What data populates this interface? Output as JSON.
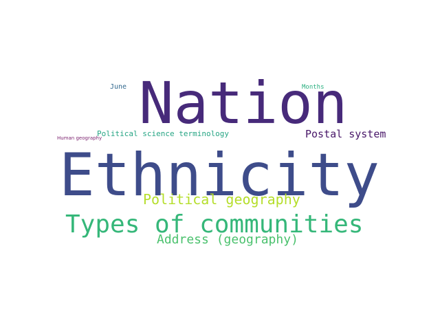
{
  "words": {
    "nation": {
      "text": "Nation",
      "color": "#472a7a"
    },
    "ethnicity": {
      "text": "Ethnicity",
      "color": "#3e4c8a"
    },
    "types": {
      "text": "Types of communities",
      "color": "#35b779"
    },
    "polgeo": {
      "text": "Political geography",
      "color": "#b5de2b"
    },
    "address": {
      "text": "Address (geography)",
      "color": "#4ac16d"
    },
    "postal": {
      "text": "Postal system",
      "color": "#481668"
    },
    "polsci": {
      "text": "Political science terminology",
      "color": "#26a584"
    },
    "june": {
      "text": "June",
      "color": "#31688e"
    },
    "months": {
      "text": "Months",
      "color": "#29af7f"
    },
    "humangeo": {
      "text": "Human geography",
      "color": "#7a1f6d"
    }
  }
}
